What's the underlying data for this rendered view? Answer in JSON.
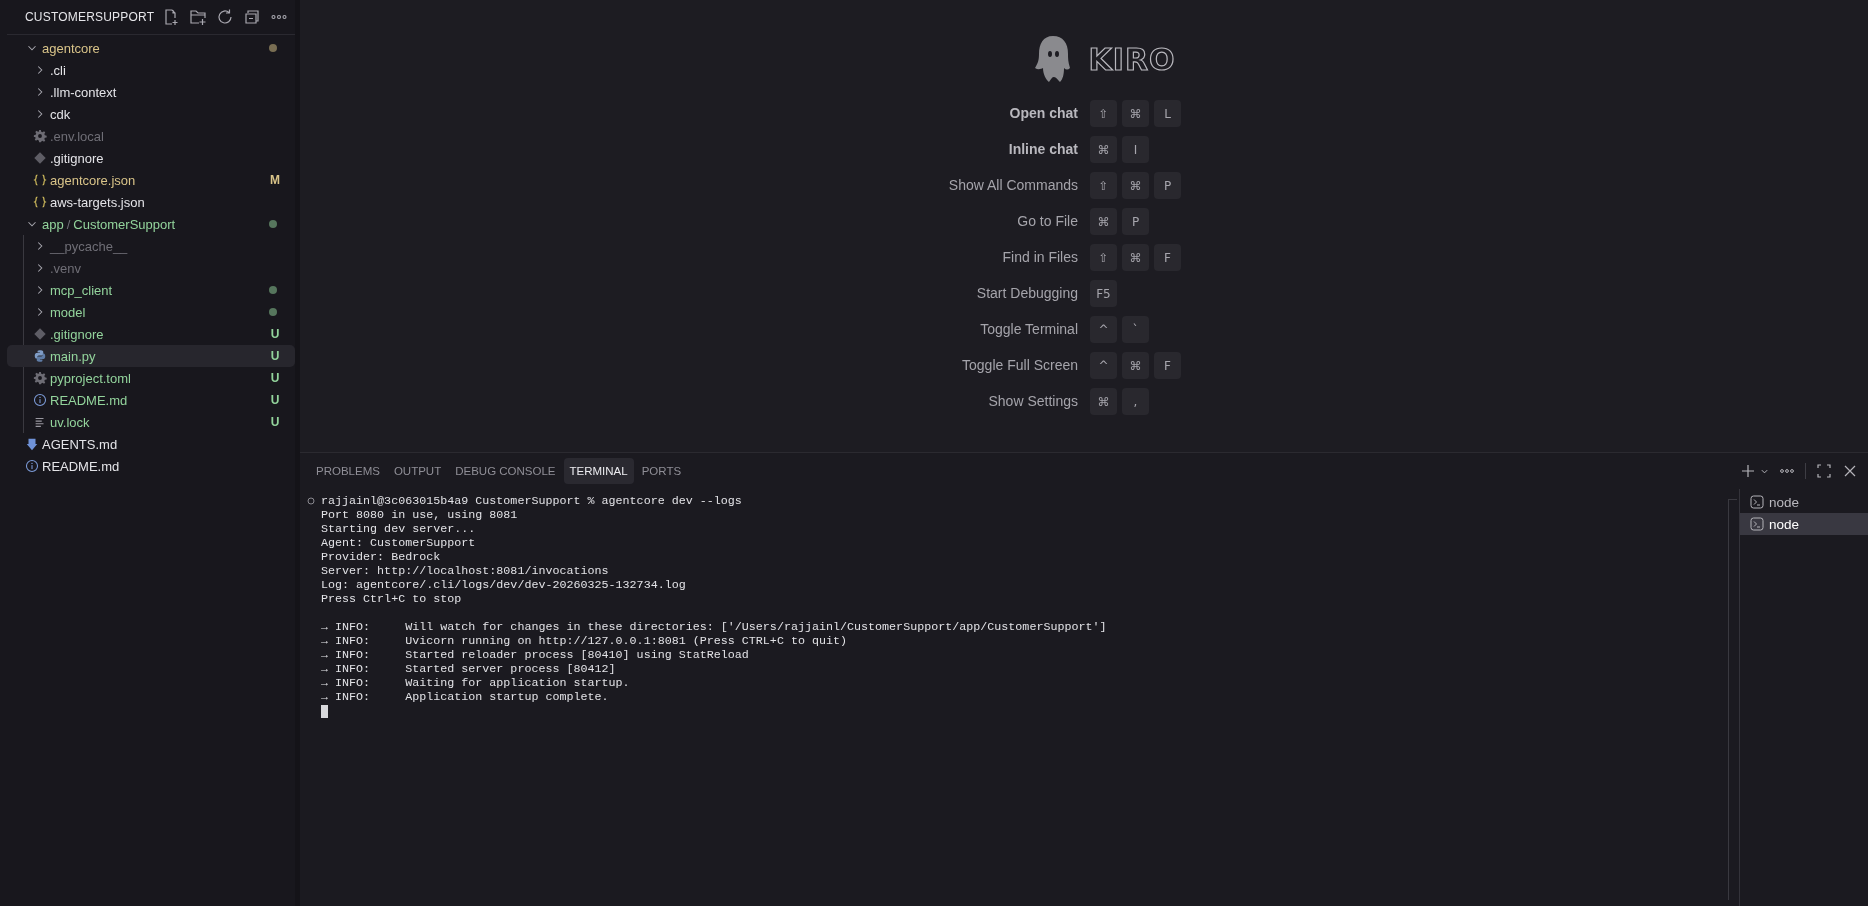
{
  "sidebar": {
    "title": "CUSTOMERSUPPORT",
    "tree": [
      {
        "name": "agentcore",
        "kind": "folder",
        "expanded": true,
        "color": "#d9c489",
        "dot": true,
        "selected": false,
        "children": [
          {
            "name": ".cli",
            "kind": "folder",
            "expanded": false,
            "color": "#e4e4e8",
            "selected": false
          },
          {
            "name": ".llm-context",
            "kind": "folder",
            "expanded": false,
            "color": "#e4e4e8",
            "selected": false
          },
          {
            "name": "cdk",
            "kind": "folder",
            "expanded": false,
            "color": "#e4e4e8",
            "selected": false
          },
          {
            "name": ".env.local",
            "kind": "config",
            "color": "#6f6e76",
            "selected": false
          },
          {
            "name": ".gitignore",
            "kind": "gitignore",
            "color": "#e4e4e8",
            "selected": false
          },
          {
            "name": "agentcore.json",
            "kind": "json",
            "color": "#d9c489",
            "badge": "M",
            "selected": false
          },
          {
            "name": "aws-targets.json",
            "kind": "json",
            "color": "#e4e4e8",
            "selected": false
          }
        ]
      },
      {
        "name": "app/CustomerSupport",
        "kind": "folder",
        "expanded": true,
        "color": "#93d49c",
        "dot": true,
        "selected": false,
        "children": [
          {
            "name": "__pycache__",
            "kind": "folder",
            "expanded": false,
            "color": "#6f6e76",
            "selected": false
          },
          {
            "name": ".venv",
            "kind": "folder",
            "expanded": false,
            "color": "#6f6e76",
            "selected": false
          },
          {
            "name": "mcp_client",
            "kind": "folder",
            "expanded": false,
            "color": "#93d49c",
            "dot": true,
            "selected": false
          },
          {
            "name": "model",
            "kind": "folder",
            "expanded": false,
            "color": "#93d49c",
            "dot": true,
            "selected": false
          },
          {
            "name": ".gitignore",
            "kind": "gitignore",
            "color": "#93d49c",
            "badge": "U",
            "selected": false
          },
          {
            "name": "main.py",
            "kind": "python",
            "color": "#93d49c",
            "badge": "U",
            "selected": true
          },
          {
            "name": "pyproject.toml",
            "kind": "config",
            "color": "#93d49c",
            "badge": "U",
            "selected": false
          },
          {
            "name": "README.md",
            "kind": "readme",
            "color": "#93d49c",
            "badge": "U",
            "selected": false
          },
          {
            "name": "uv.lock",
            "kind": "lockfile",
            "color": "#93d49c",
            "badge": "U",
            "selected": false
          }
        ]
      },
      {
        "name": "AGENTS.md",
        "kind": "agents",
        "color": "#e4e4e8",
        "selected": false
      },
      {
        "name": "README.md",
        "kind": "readme",
        "color": "#e4e4e8",
        "selected": false
      }
    ]
  },
  "editor": {
    "logo": "KIRO",
    "shortcuts": [
      {
        "label": "Open chat",
        "emphasis": true,
        "keys": [
          "⇧",
          "⌘",
          "L"
        ]
      },
      {
        "label": "Inline chat",
        "emphasis": true,
        "keys": [
          "⌘",
          "I"
        ]
      },
      {
        "label": "Show All Commands",
        "emphasis": false,
        "keys": [
          "⇧",
          "⌘",
          "P"
        ]
      },
      {
        "label": "Go to File",
        "emphasis": false,
        "keys": [
          "⌘",
          "P"
        ]
      },
      {
        "label": "Find in Files",
        "emphasis": false,
        "keys": [
          "⇧",
          "⌘",
          "F"
        ]
      },
      {
        "label": "Start Debugging",
        "emphasis": false,
        "keys": [
          "F5"
        ]
      },
      {
        "label": "Toggle Terminal",
        "emphasis": false,
        "keys": [
          "^",
          "`"
        ]
      },
      {
        "label": "Toggle Full Screen",
        "emphasis": false,
        "keys": [
          "^",
          "⌘",
          "F"
        ]
      },
      {
        "label": "Show Settings",
        "emphasis": false,
        "keys": [
          "⌘",
          ","
        ]
      }
    ]
  },
  "panel": {
    "tabs": [
      {
        "label": "PROBLEMS",
        "selected": false
      },
      {
        "label": "OUTPUT",
        "selected": false
      },
      {
        "label": "DEBUG CONSOLE",
        "selected": false
      },
      {
        "label": "TERMINAL",
        "selected": true
      },
      {
        "label": "PORTS",
        "selected": false
      }
    ],
    "terminal": {
      "cursor": true,
      "lines": [
        {
          "kind": "command",
          "text": "rajjainl@3c063015b4a9 CustomerSupport % agentcore dev --logs"
        },
        {
          "kind": "output",
          "text": "Port 8080 in use, using 8081"
        },
        {
          "kind": "output",
          "text": "Starting dev server..."
        },
        {
          "kind": "output",
          "text": "Agent: CustomerSupport"
        },
        {
          "kind": "output",
          "text": "Provider: Bedrock"
        },
        {
          "kind": "output",
          "text": "Server: http://localhost:8081/invocations"
        },
        {
          "kind": "output",
          "text": "Log: agentcore/.cli/logs/dev/dev-20260325-132734.log"
        },
        {
          "kind": "output",
          "text": "Press Ctrl+C to stop"
        },
        {
          "kind": "blank"
        },
        {
          "kind": "output",
          "text": "→ INFO:     Will watch for changes in these directories: ['/Users/rajjainl/CustomerSupport/app/CustomerSupport']"
        },
        {
          "kind": "output",
          "text": "→ INFO:     Uvicorn running on http://127.0.0.1:8081 (Press CTRL+C to quit)"
        },
        {
          "kind": "output",
          "text": "→ INFO:     Started reloader process [80410] using StatReload"
        },
        {
          "kind": "output",
          "text": "→ INFO:     Started server process [80412]"
        },
        {
          "kind": "output",
          "text": "→ INFO:     Waiting for application startup."
        },
        {
          "kind": "output",
          "text": "→ INFO:     Application startup complete."
        }
      ]
    },
    "sessions": [
      {
        "label": "node",
        "selected": false
      },
      {
        "label": "node",
        "selected": true
      }
    ]
  }
}
